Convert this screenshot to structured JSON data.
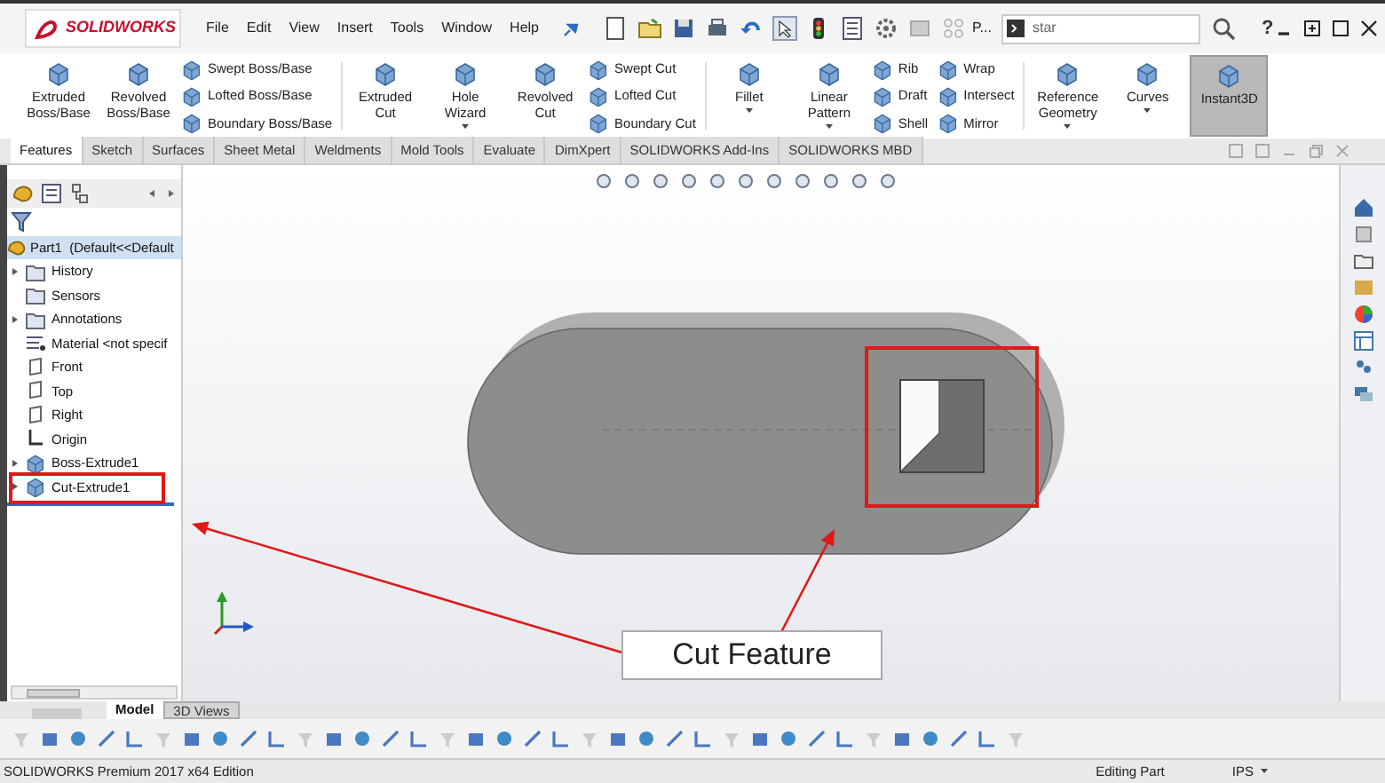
{
  "title_bar": {
    "logo": "SOLIDWORKS",
    "menu": [
      "File",
      "Edit",
      "View",
      "Insert",
      "Tools",
      "Window",
      "Help"
    ],
    "doc_label": "P...",
    "search": {
      "value": "star"
    },
    "help": "?"
  },
  "ribbon": {
    "groups": [
      {
        "items": [
          {
            "kind": "large",
            "label": "Extruded Boss/Base",
            "dropdown": false,
            "on": false
          },
          {
            "kind": "large",
            "label": "Revolved Boss/Base",
            "dropdown": false,
            "on": false
          },
          {
            "kind": "stack",
            "labels": [
              "Swept Boss/Base",
              "Lofted Boss/Base",
              "Boundary Boss/Base"
            ],
            "on": false
          }
        ]
      },
      {
        "items": [
          {
            "kind": "large",
            "label": "Extruded Cut",
            "dropdown": false,
            "on": false
          },
          {
            "kind": "large",
            "label": "Hole Wizard",
            "dropdown": true,
            "on": false
          },
          {
            "kind": "large",
            "label": "Revolved Cut",
            "dropdown": false,
            "on": false
          },
          {
            "kind": "stack",
            "labels": [
              "Swept Cut",
              "Lofted Cut",
              "Boundary Cut"
            ],
            "on": false
          }
        ]
      },
      {
        "items": [
          {
            "kind": "large",
            "label": "Fillet",
            "dropdown": true,
            "on": false
          },
          {
            "kind": "large",
            "label": "Linear Pattern",
            "dropdown": true,
            "on": false
          },
          {
            "kind": "stack",
            "labels": [
              "Rib",
              "Draft",
              "Shell"
            ],
            "on": false
          },
          {
            "kind": "stack",
            "labels": [
              "Wrap",
              "Intersect",
              "Mirror"
            ],
            "on": false
          }
        ]
      },
      {
        "items": [
          {
            "kind": "large",
            "label": "Reference Geometry",
            "dropdown": true,
            "on": false
          },
          {
            "kind": "large",
            "label": "Curves",
            "dropdown": true,
            "on": false
          },
          {
            "kind": "large",
            "label": "Instant3D",
            "dropdown": false,
            "on": true
          }
        ]
      }
    ]
  },
  "tabs": [
    {
      "label": "Features",
      "selected": true
    },
    {
      "label": "Sketch",
      "selected": false
    },
    {
      "label": "Surfaces",
      "selected": false
    },
    {
      "label": "Sheet Metal",
      "selected": false
    },
    {
      "label": "Weldments",
      "selected": false
    },
    {
      "label": "Mold Tools",
      "selected": false
    },
    {
      "label": "Evaluate",
      "selected": false
    },
    {
      "label": "DimXpert",
      "selected": false
    },
    {
      "label": "SOLIDWORKS Add-Ins",
      "selected": false
    },
    {
      "label": "SOLIDWORKS MBD",
      "selected": false
    }
  ],
  "feature_tree": {
    "root": {
      "label": "Part1  (Default<<Default",
      "selected": true
    },
    "items": [
      {
        "kind": "folder",
        "label": "History",
        "expandable": true,
        "annotated": false
      },
      {
        "kind": "folder",
        "label": "Sensors",
        "expandable": false,
        "annotated": false
      },
      {
        "kind": "folder",
        "label": "Annotations",
        "expandable": true,
        "annotated": false
      },
      {
        "kind": "material",
        "label": "Material <not specif",
        "expandable": false,
        "annotated": false
      },
      {
        "kind": "plane",
        "label": "Front",
        "expandable": false,
        "annotated": false
      },
      {
        "kind": "plane",
        "label": "Top",
        "expandable": false,
        "annotated": false
      },
      {
        "kind": "plane",
        "label": "Right",
        "expandable": false,
        "annotated": false
      },
      {
        "kind": "origin",
        "label": "Origin",
        "expandable": false,
        "annotated": false
      },
      {
        "kind": "feature",
        "label": "Boss-Extrude1",
        "expandable": true,
        "annotated": false
      },
      {
        "kind": "feature",
        "label": "Cut-Extrude1",
        "expandable": true,
        "annotated": true
      }
    ]
  },
  "annotation": {
    "label": "Cut Feature"
  },
  "model_tabs": [
    {
      "label": "Model",
      "selected": true
    },
    {
      "label": "3D Views",
      "selected": false
    }
  ],
  "status_bar": {
    "edition": "SOLIDWORKS Premium 2017 x64 Edition",
    "mode": "Editing Part",
    "units": "IPS"
  }
}
